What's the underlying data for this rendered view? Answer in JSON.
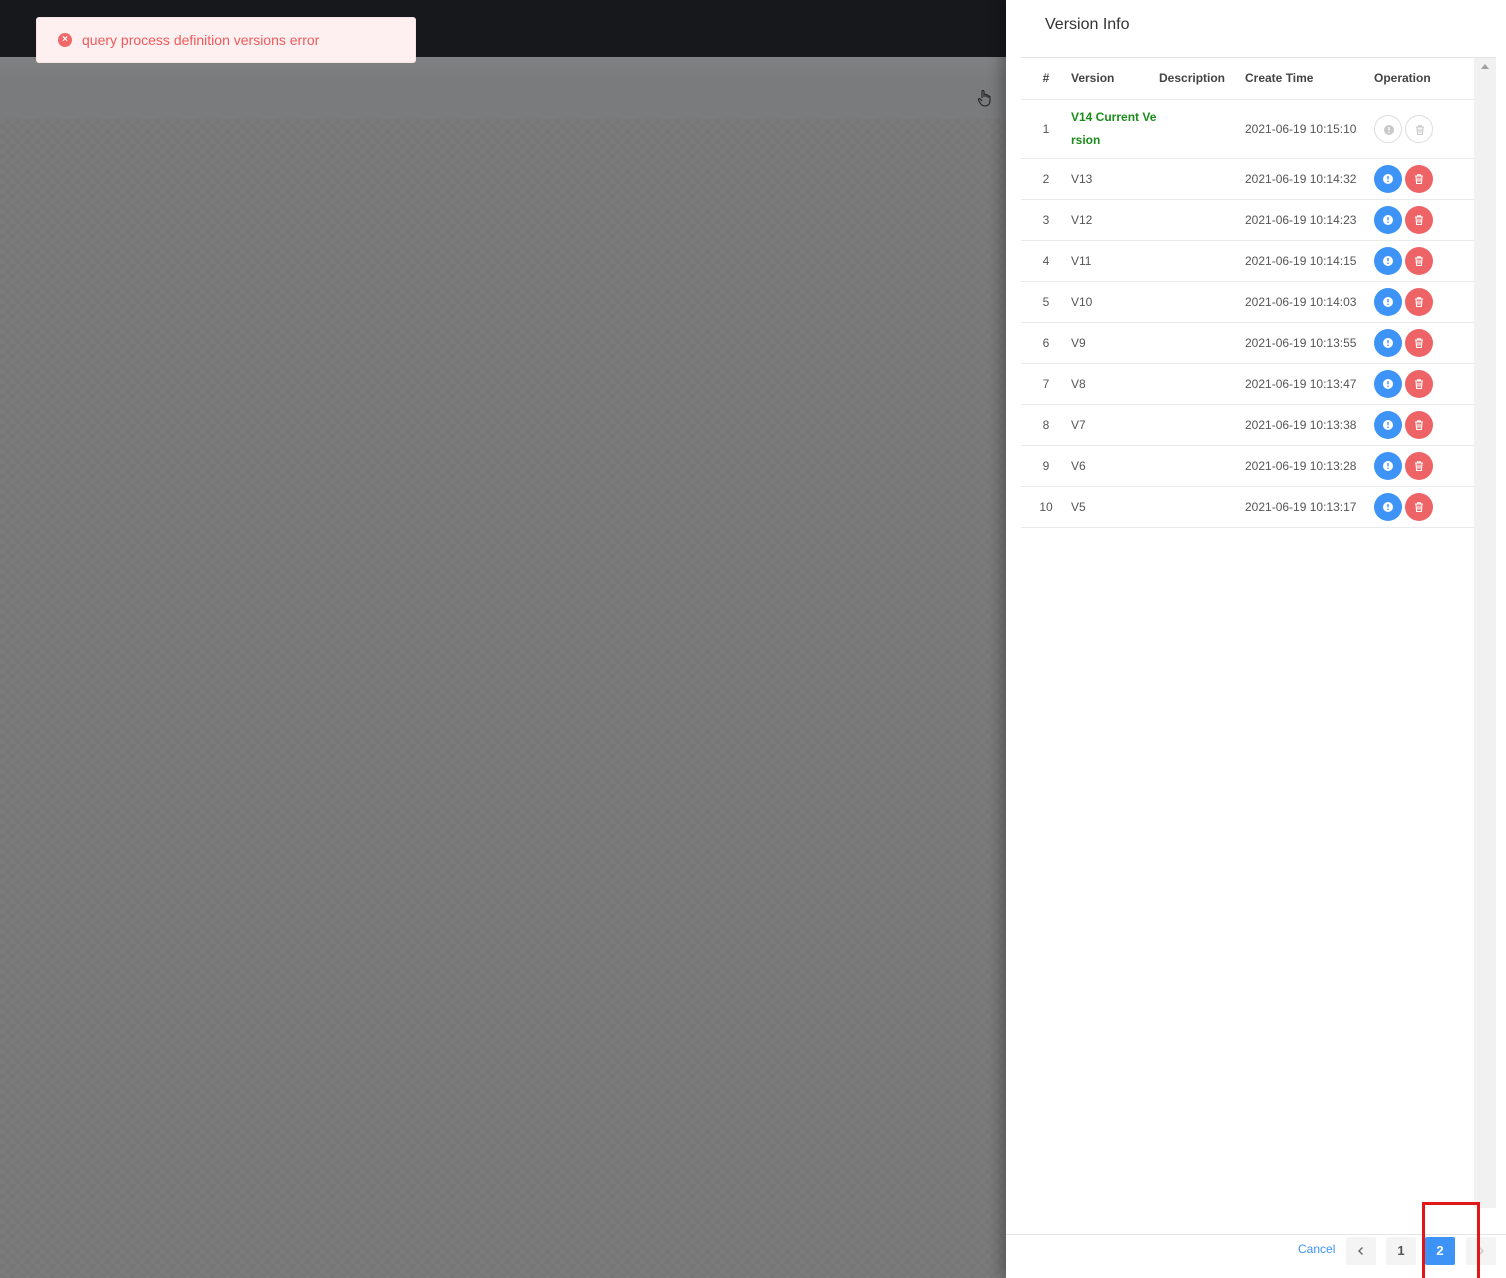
{
  "toast": {
    "message": "query process definition versions error"
  },
  "drawer": {
    "title": "Version Info",
    "columns": [
      "#",
      "Version",
      "Description",
      "Create Time",
      "Operation"
    ],
    "rows": [
      {
        "idx": "1",
        "version": "V14 Current Ve rsion",
        "description": "",
        "time": "2021-06-19 10:15:10",
        "current": true
      },
      {
        "idx": "2",
        "version": "V13",
        "description": "",
        "time": "2021-06-19 10:14:32"
      },
      {
        "idx": "3",
        "version": "V12",
        "description": "",
        "time": "2021-06-19 10:14:23"
      },
      {
        "idx": "4",
        "version": "V11",
        "description": "",
        "time": "2021-06-19 10:14:15"
      },
      {
        "idx": "5",
        "version": "V10",
        "description": "",
        "time": "2021-06-19 10:14:03"
      },
      {
        "idx": "6",
        "version": "V9",
        "description": "",
        "time": "2021-06-19 10:13:55"
      },
      {
        "idx": "7",
        "version": "V8",
        "description": "",
        "time": "2021-06-19 10:13:47"
      },
      {
        "idx": "8",
        "version": "V7",
        "description": "",
        "time": "2021-06-19 10:13:38"
      },
      {
        "idx": "9",
        "version": "V6",
        "description": "",
        "time": "2021-06-19 10:13:28"
      },
      {
        "idx": "10",
        "version": "V5",
        "description": "",
        "time": "2021-06-19 10:13:17"
      }
    ],
    "footer": {
      "cancel_label": "Cancel",
      "pages": [
        "1",
        "2"
      ],
      "current_page": "2"
    }
  },
  "colors": {
    "primary": "#3d94f6",
    "danger": "#ee6466",
    "current_version": "#1a8c1a",
    "error_text": "#f05a5a"
  },
  "icons": {
    "switch_version": "clock-icon",
    "delete": "trash-icon",
    "prev": "chevron-left-icon",
    "next": "chevron-right-icon",
    "toolbar": "hand-pointer-icon",
    "toast": "error-circle-icon"
  }
}
